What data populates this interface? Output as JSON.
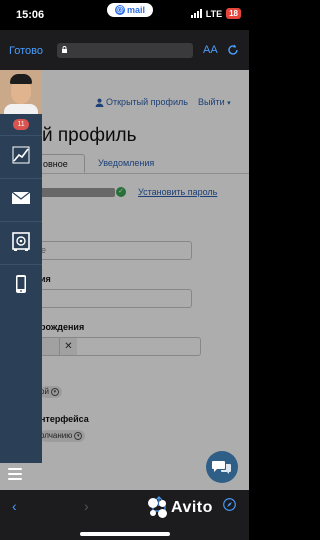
{
  "status_bar": {
    "time": "15:06",
    "pill_label": "mail",
    "network": "LTE",
    "battery": "18",
    "accent": "#2f6ee6"
  },
  "safari_top": {
    "done_label": "Готово",
    "text_size_label": "AA",
    "lock_icon": "lock-icon",
    "reload_icon": "reload-icon"
  },
  "page": {
    "open_profile_label": "Открытый профиль",
    "logout_label": "Выйти",
    "title": "й профиль",
    "tabs": [
      {
        "label": "овное"
      },
      {
        "label": "Уведомления"
      }
    ],
    "set_password_label": "Установить пароль",
    "fields": {
      "name_value": "е",
      "surname_label": "ия",
      "birth_label": "рождения",
      "date_clear": "✕",
      "gender_value": "ой",
      "interface_label": "нтерфейса",
      "interface_value": "олчанию"
    },
    "link_color": "#2a5fb0"
  },
  "sidebar": {
    "badge_count": "11",
    "items": [
      {
        "name": "stats-icon"
      },
      {
        "name": "mail-icon"
      },
      {
        "name": "safe-icon"
      },
      {
        "name": "phone-icon"
      }
    ],
    "bg_color": "#2b4057"
  },
  "bottom": {
    "back_glyph": "‹",
    "forward_glyph": "›",
    "watermark": "Avito"
  }
}
